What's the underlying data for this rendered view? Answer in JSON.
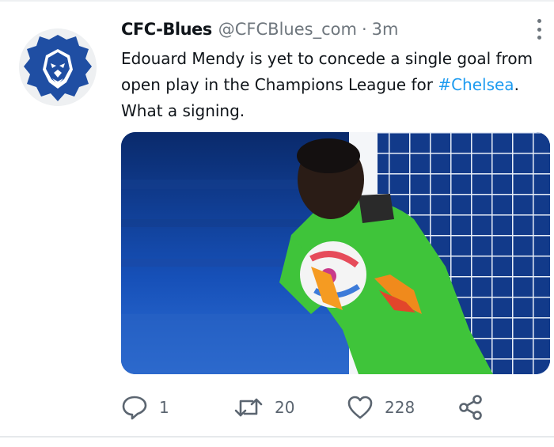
{
  "tweet": {
    "display_name": "CFC-Blues",
    "handle": "@CFCBlues_com",
    "separator": "·",
    "time": "3m",
    "text_before": "Edouard Mendy is yet to concede a single goal from open play in the Champions League for ",
    "hashtag": "#Chelsea",
    "text_after": ". What a signing.",
    "avatar_icon": "lion-logo-icon",
    "media_description_icon": "goalkeeper-photo"
  },
  "actions": {
    "reply_count": "1",
    "retweet_count": "20",
    "like_count": "228"
  },
  "colors": {
    "accent": "#1d9bf0",
    "avatar_blue": "#1f4ea3",
    "text_secondary": "#6e767d"
  }
}
